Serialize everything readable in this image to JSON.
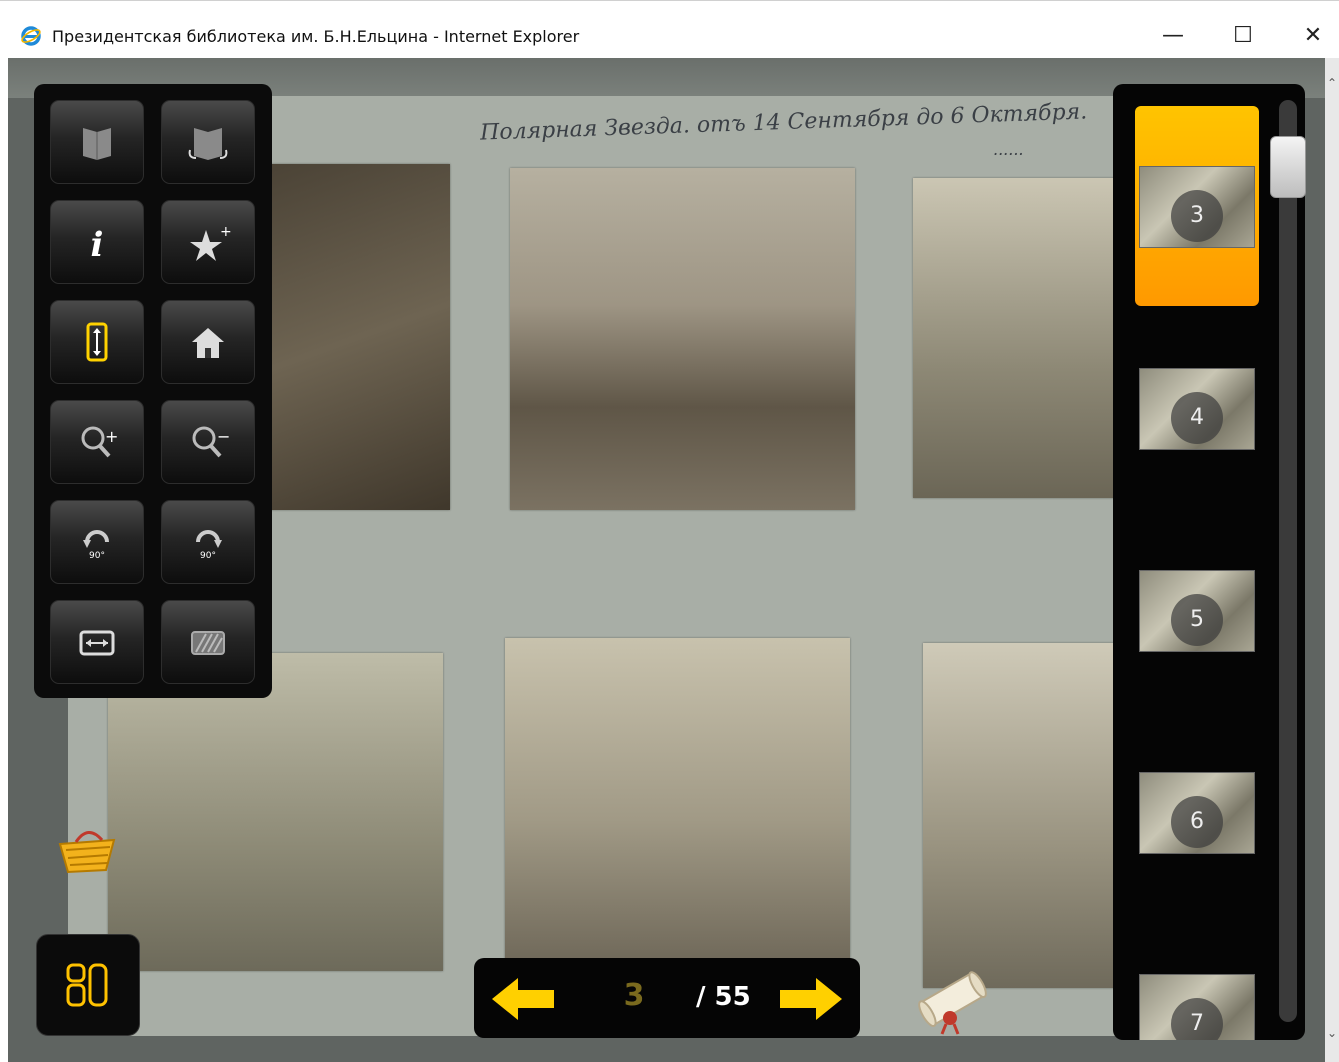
{
  "window": {
    "title": "Президентская библиотека им. Б.Н.Ельцина - Internet Explorer",
    "minimize_glyph": "—",
    "maximize_glyph": "☐",
    "close_glyph": "✕"
  },
  "page": {
    "handwritten_caption": "Полярная Звезда. отъ 14 Сентября до 6 Октября.",
    "handwritten_caption_2": "......"
  },
  "toolbar": {
    "buttons": [
      {
        "icon": "single-page-icon",
        "interactable": true
      },
      {
        "icon": "two-page-icon",
        "interactable": true
      },
      {
        "icon": "info-icon",
        "interactable": true
      },
      {
        "icon": "add-bookmark-icon",
        "interactable": true
      },
      {
        "icon": "fit-height-icon",
        "interactable": true,
        "active": true
      },
      {
        "icon": "home-icon",
        "interactable": true
      },
      {
        "icon": "zoom-in-icon",
        "interactable": true
      },
      {
        "icon": "zoom-out-icon",
        "interactable": true
      },
      {
        "icon": "rotate-left-icon",
        "interactable": true
      },
      {
        "icon": "rotate-right-icon",
        "interactable": true
      },
      {
        "icon": "fit-width-icon",
        "interactable": true
      },
      {
        "icon": "contrast-icon",
        "interactable": true
      }
    ],
    "rotate_label": "90°",
    "accent_color": "#ffd200"
  },
  "navigation": {
    "current_page": "3",
    "total_label": "/ 55",
    "arrow_color": "#ffd000"
  },
  "thumbnails": {
    "items": [
      {
        "number": "3",
        "active": true
      },
      {
        "number": "4",
        "active": false
      },
      {
        "number": "5",
        "active": false
      },
      {
        "number": "6",
        "active": false
      },
      {
        "number": "7",
        "active": false
      }
    ],
    "active_color": "#ffb000"
  },
  "icons": {
    "basket": "basket-icon",
    "grid": "grid-view-icon",
    "scroll": "scroll-icon",
    "browser": "ie-icon"
  }
}
